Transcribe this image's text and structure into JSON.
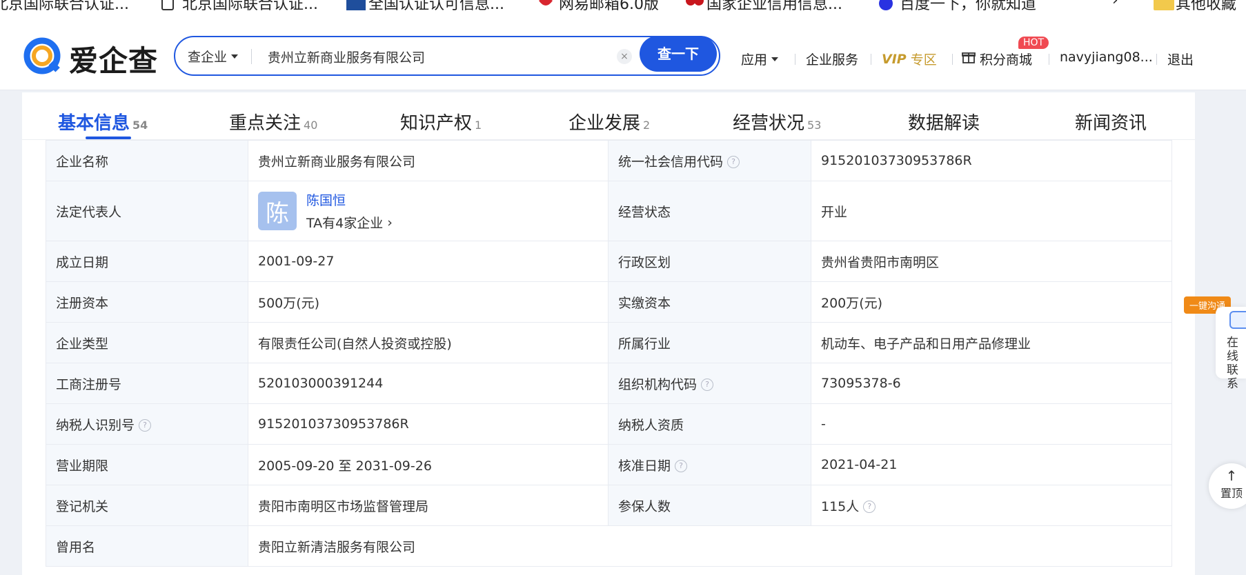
{
  "bookmarks": [
    {
      "label": "北京国际联合认证..."
    },
    {
      "label": "北京国际联合认证..."
    },
    {
      "label": "全国认证认可信息..."
    },
    {
      "label": "网易邮箱6.0版"
    },
    {
      "label": "国家企业信用信息..."
    },
    {
      "label": "百度一下，你就知道"
    },
    {
      "label": "其他收藏"
    }
  ],
  "header": {
    "logo_text": "爱企查",
    "search_type": "查企业",
    "search_value": "贵州立新商业服务有限公司",
    "search_button": "查一下",
    "clear_symbol": "×",
    "nav": {
      "apps": "应用",
      "enterprise_service": "企业服务",
      "vip": "VIP",
      "vip_zone": "专区",
      "points_mall": "积分商城",
      "hot_badge": "HOT",
      "username": "navyjiang08...",
      "logout": "退出"
    }
  },
  "tabs": [
    {
      "label": "基本信息",
      "count": "54",
      "active": true
    },
    {
      "label": "重点关注",
      "count": "40"
    },
    {
      "label": "知识产权",
      "count": "1"
    },
    {
      "label": "企业发展",
      "count": "2"
    },
    {
      "label": "经营状况",
      "count": "53"
    },
    {
      "label": "数据解读",
      "count": ""
    },
    {
      "label": "新闻资讯",
      "count": ""
    }
  ],
  "info": {
    "company_name_label": "企业名称",
    "company_name": "贵州立新商业服务有限公司",
    "credit_code_label": "统一社会信用代码",
    "credit_code": "91520103730953786R",
    "legal_rep_label": "法定代表人",
    "legal_rep_avatar": "陈",
    "legal_rep_name": "陈国恒",
    "legal_rep_companies": "TA有4家企业",
    "status_label": "经营状态",
    "status": "开业",
    "founded_label": "成立日期",
    "founded": "2001-09-27",
    "region_label": "行政区划",
    "region": "贵州省贵阳市南明区",
    "reg_capital_label": "注册资本",
    "reg_capital": "500万(元)",
    "paid_capital_label": "实缴资本",
    "paid_capital": "200万(元)",
    "company_type_label": "企业类型",
    "company_type": "有限责任公司(自然人投资或控股)",
    "industry_label": "所属行业",
    "industry": "机动车、电子产品和日用产品修理业",
    "reg_no_label": "工商注册号",
    "reg_no": "520103000391244",
    "org_code_label": "组织机构代码",
    "org_code": "73095378-6",
    "taxpayer_id_label": "纳税人识别号",
    "taxpayer_id": "91520103730953786R",
    "taxpayer_qual_label": "纳税人资质",
    "taxpayer_qual": "-",
    "term_label": "营业期限",
    "term": "2005-09-20 至 2031-09-26",
    "approval_date_label": "核准日期",
    "approval_date": "2021-04-21",
    "reg_authority_label": "登记机关",
    "reg_authority": "贵阳市南明区市场监督管理局",
    "insured_label": "参保人数",
    "insured": "115人",
    "former_name_label": "曾用名",
    "former_name": "贵阳立新清洁服务有限公司"
  },
  "float": {
    "chat_badge": "一键沟通",
    "chat_text": "在线联系",
    "top_label": "置顶",
    "top_arrow": "↑"
  },
  "colors": {
    "brand_blue": "#1f57e0",
    "vip_gold": "#c69b2e",
    "hot_red": "#f04a52",
    "chat_orange": "#f08a17"
  }
}
